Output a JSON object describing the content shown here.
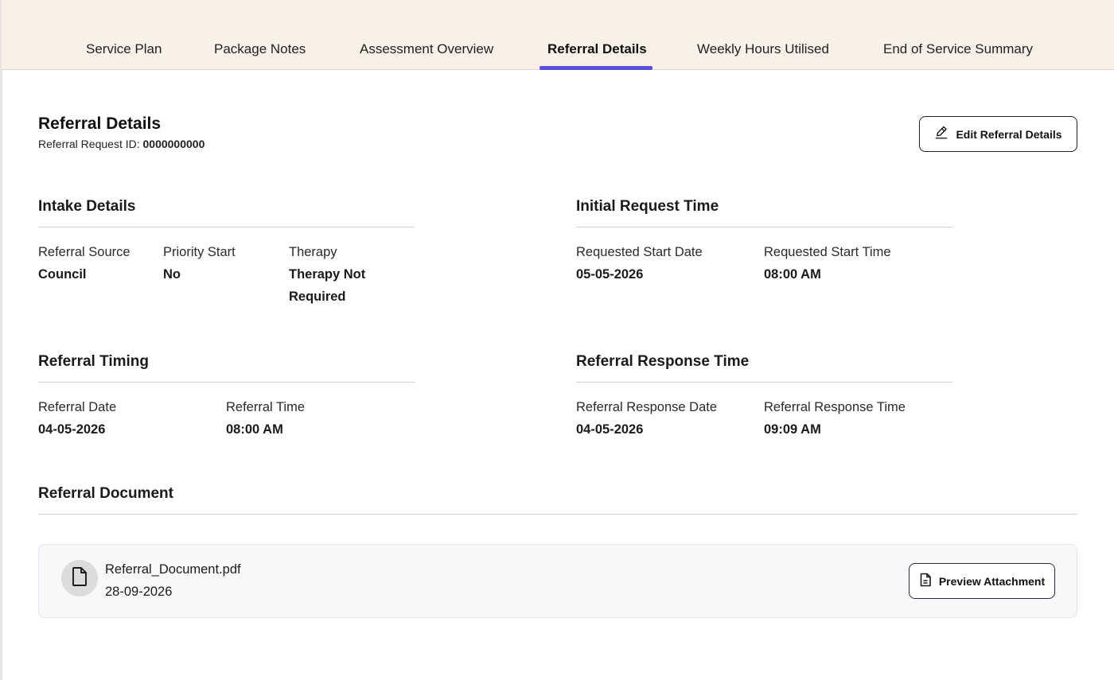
{
  "tabs": [
    {
      "label": "Service Plan"
    },
    {
      "label": "Package Notes"
    },
    {
      "label": "Assessment Overview"
    },
    {
      "label": "Referral Details"
    },
    {
      "label": "Weekly Hours Utilised"
    },
    {
      "label": "End of Service Summary"
    }
  ],
  "active_tab": "Referral Details",
  "header": {
    "title": "Referral Details",
    "request_id_label": "Referral Request ID:",
    "request_id_value": "0000000000",
    "edit_button_label": "Edit Referral Details",
    "edit_icon": "pencil-icon"
  },
  "intake": {
    "title": "Intake Details",
    "referral_source_label": "Referral Source",
    "referral_source_value": "Council",
    "priority_start_label": "Priority Start",
    "priority_start_value": "No",
    "therapy_label": "Therapy",
    "therapy_value": "Therapy Not Required"
  },
  "initial_request": {
    "title": "Initial Request Time",
    "start_date_label": "Requested Start Date",
    "start_date_value": "05-05-2026",
    "start_time_label": "Requested Start Time",
    "start_time_value": "08:00 AM"
  },
  "timing": {
    "title": "Referral Timing",
    "date_label": "Referral Date",
    "date_value": "04-05-2026",
    "time_label": "Referral Time",
    "time_value": "08:00 AM"
  },
  "response": {
    "title": "Referral Response Time",
    "date_label": "Referral Response Date",
    "date_value": "04-05-2026",
    "time_label": "Referral Response Time",
    "time_value": "09:09 AM"
  },
  "document": {
    "title": "Referral Document",
    "file_name": "Referral_Document.pdf",
    "file_date": "28-09-2026",
    "preview_label": "Preview Attachment",
    "file_icon": "file-icon",
    "preview_icon": "document-icon"
  },
  "colors": {
    "tabbar_bg": "#f9f1e8",
    "accent": "#5b4fd9",
    "doc_card_bg": "#f7f8fa"
  }
}
